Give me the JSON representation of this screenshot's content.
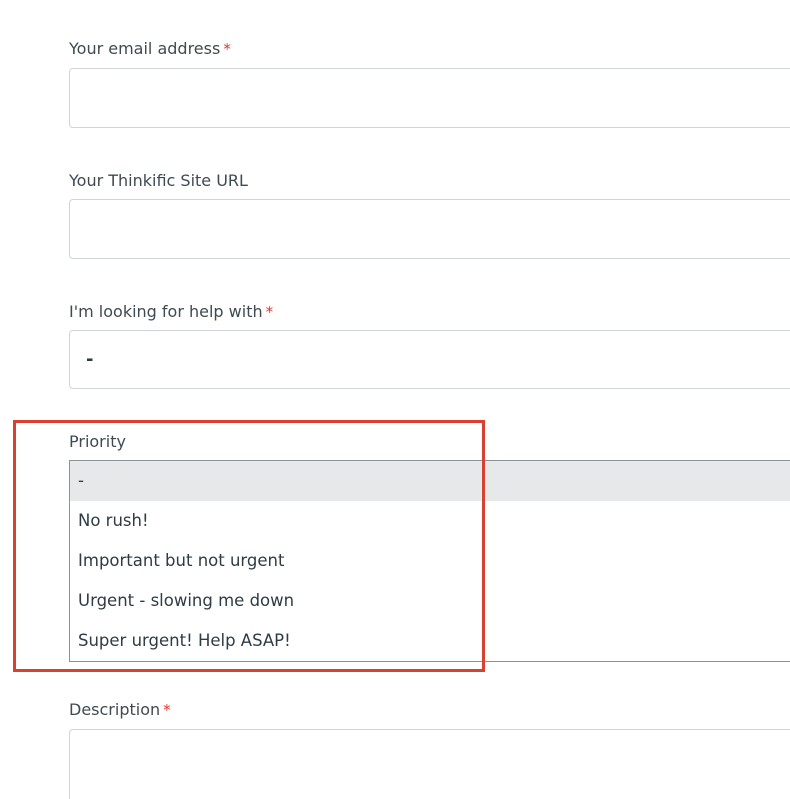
{
  "form": {
    "email": {
      "label": "Your email address",
      "required_mark": "*",
      "value": ""
    },
    "site_url": {
      "label": "Your Thinkific Site URL",
      "value": ""
    },
    "help_with": {
      "label": "I'm looking for help with",
      "required_mark": "*",
      "value": "-"
    },
    "priority": {
      "label": "Priority",
      "options": [
        "-",
        "No rush!",
        "Important but not urgent",
        "Urgent - slowing me down",
        "Super urgent! Help ASAP!"
      ],
      "selected_option": "-"
    },
    "description": {
      "label": "Description",
      "required_mark": "*",
      "value": ""
    }
  },
  "colors": {
    "required": "#d9392b",
    "highlight_box": "#d8402f",
    "selected_option_bg": "#e6e8e9",
    "field_border": "#cfd4d8"
  }
}
